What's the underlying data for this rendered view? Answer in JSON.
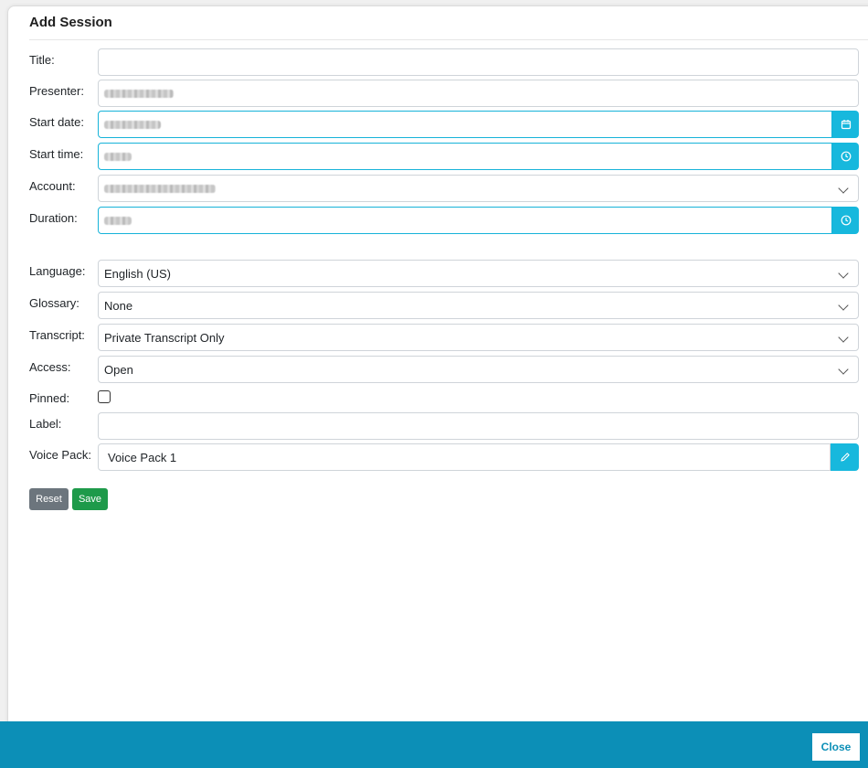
{
  "dialog": {
    "title": "Add Session"
  },
  "form": {
    "title": {
      "label": "Title:",
      "value": ""
    },
    "presenter": {
      "label": "Presenter:"
    },
    "start_date": {
      "label": "Start date:"
    },
    "start_time": {
      "label": "Start time:"
    },
    "account": {
      "label": "Account:"
    },
    "duration": {
      "label": "Duration:"
    },
    "language": {
      "label": "Language:",
      "value": "English (US)"
    },
    "glossary": {
      "label": "Glossary:",
      "value": "None"
    },
    "transcript": {
      "label": "Transcript:",
      "value": "Private Transcript Only"
    },
    "access": {
      "label": "Access:",
      "value": "Open"
    },
    "pinned": {
      "label": "Pinned:",
      "checked": false
    },
    "label_field": {
      "label": "Label:",
      "value": ""
    },
    "voice_pack": {
      "label": "Voice Pack:",
      "value": "Voice Pack 1"
    }
  },
  "buttons": {
    "reset": "Reset",
    "save": "Save",
    "close": "Close"
  },
  "icons": {
    "start_date": "calendar-icon",
    "start_time": "clock-icon",
    "duration": "clock-icon",
    "voice_pack": "pencil-icon",
    "select": "chevron-down-icon"
  },
  "colors": {
    "accent": "#17b8dd",
    "footer": "#0c8fb7",
    "reset": "#6c757d",
    "save": "#1e9a4a"
  }
}
